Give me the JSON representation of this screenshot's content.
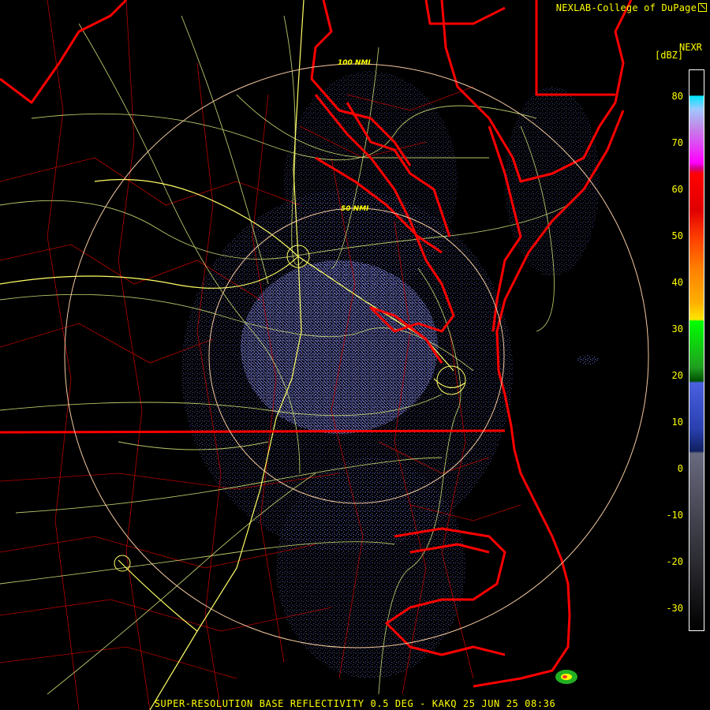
{
  "credit": "NEXLAB-College of DuPage",
  "product": "NEXR",
  "unit": "[dBZ]",
  "title": "SUPER-RESOLUTION BASE REFLECTIVITY 0.5 DEG - KAKQ 25 JUN 25 08:36",
  "range_rings": [
    {
      "label": "50 NMI"
    },
    {
      "label": "100 NMI"
    }
  ],
  "colorbar": {
    "ticks": [
      "80",
      "70",
      "60",
      "50",
      "40",
      "30",
      "20",
      "10",
      "0",
      "-10",
      "-20",
      "-30"
    ],
    "colors": {
      "ring": "#f4c9a0",
      "coast": "#ff0000",
      "roads": "#d8e87a",
      "highways": "#ffff66",
      "counties": "#b80000",
      "echo_light": "#5a66d6",
      "echo_faint": "#7c7cd8"
    }
  }
}
